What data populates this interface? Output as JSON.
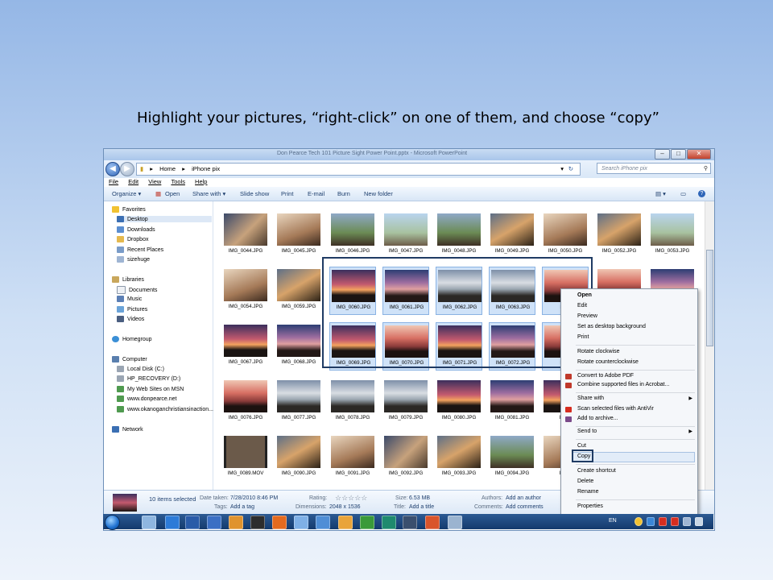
{
  "instruction": "Highlight your pictures, “right-click” on one of them, and choose “copy”",
  "window": {
    "title": "Don Pearce Tech 101 Picture Sight Power Point.pptx - Microsoft PowerPoint",
    "controls": {
      "minimize": "–",
      "maximize": "□",
      "close": "✕"
    }
  },
  "address": {
    "crumbs": [
      "Home",
      "iPhone pix"
    ],
    "search_placeholder": "Search iPhone pix"
  },
  "menu": [
    "File",
    "Edit",
    "View",
    "Tools",
    "Help"
  ],
  "toolbar": [
    "Organize ▾",
    "Open",
    "Share with ▾",
    "Slide show",
    "Print",
    "E-mail",
    "Burn",
    "New folder"
  ],
  "sidebar": {
    "favorites": {
      "label": "Favorites",
      "items": [
        "Desktop",
        "Downloads",
        "Dropbox",
        "Recent Places",
        "sizehuge"
      ]
    },
    "libraries": {
      "label": "Libraries",
      "items": [
        "Documents",
        "Music",
        "Pictures",
        "Videos"
      ]
    },
    "homegroup": "Homegroup",
    "computer": {
      "label": "Computer",
      "items": [
        "Local Disk (C:)",
        "HP_RECOVERY (D:)",
        "My Web Sites on MSN",
        "www.donpearce.net",
        "www.okanoganchristiansinaction..."
      ]
    },
    "network": "Network"
  },
  "files": {
    "row1": [
      "IMG_0044.JPG",
      "IMG_0045.JPG",
      "IMG_0046.JPG",
      "IMG_0047.JPG",
      "IMG_0048.JPG",
      "IMG_0049.JPG",
      "IMG_0050.JPG",
      "IMG_0052.JPG",
      "IMG_0053.JPG"
    ],
    "row2": [
      "IMG_0054.JPG",
      "IMG_0059.JPG",
      "IMG_0060.JPG",
      "IMG_0061.JPG",
      "IMG_0062.JPG",
      "IMG_0063.JPG",
      "IMG_"
    ],
    "row3": [
      "IMG_0067.JPG",
      "IMG_0068.JPG",
      "IMG_0069.JPG",
      "IMG_0070.JPG",
      "IMG_0071.JPG",
      "IMG_0072.JPG",
      "IMG_"
    ],
    "row4": [
      "IMG_0076.JPG",
      "IMG_0077.JPG",
      "IMG_0078.JPG",
      "IMG_0079.JPG",
      "IMG_0080.JPG",
      "IMG_0081.JPG",
      "IMG_"
    ],
    "row5": [
      "IMG_0089.MOV",
      "IMG_0090.JPG",
      "IMG_0091.JPG",
      "IMG_0092.JPG",
      "IMG_0093.JPG",
      "IMG_0094.JPG",
      "IMG_"
    ]
  },
  "context_menu": {
    "open": "Open",
    "edit": "Edit",
    "preview": "Preview",
    "desktop_bg": "Set as desktop background",
    "print": "Print",
    "rot_cw": "Rotate clockwise",
    "rot_ccw": "Rotate counterclockwise",
    "pdf": "Convert to Adobe PDF",
    "combine": "Combine supported files in Acrobat...",
    "share": "Share with",
    "scan": "Scan selected files with AntiVir",
    "archive": "Add to archive...",
    "sendto": "Send to",
    "cut": "Cut",
    "copy": "Copy",
    "shortcut": "Create shortcut",
    "delete": "Delete",
    "rename": "Rename",
    "properties": "Properties"
  },
  "details": {
    "selected": "10 items selected",
    "date_label": "Date taken:",
    "date": "7/28/2010 8:46 PM",
    "tags_label": "Tags:",
    "tags": "Add a tag",
    "rating_label": "Rating:",
    "rating_stars": "☆☆☆☆☆",
    "dim_label": "Dimensions:",
    "dim": "2048 x 1536",
    "size_label": "Size:",
    "size": "6.53 MB",
    "title_label": "Title:",
    "title": "Add a title",
    "authors_label": "Authors:",
    "authors": "Add an author",
    "comments_label": "Comments:",
    "comments": "Add comments"
  },
  "taskbar": {
    "lang": "EN"
  }
}
